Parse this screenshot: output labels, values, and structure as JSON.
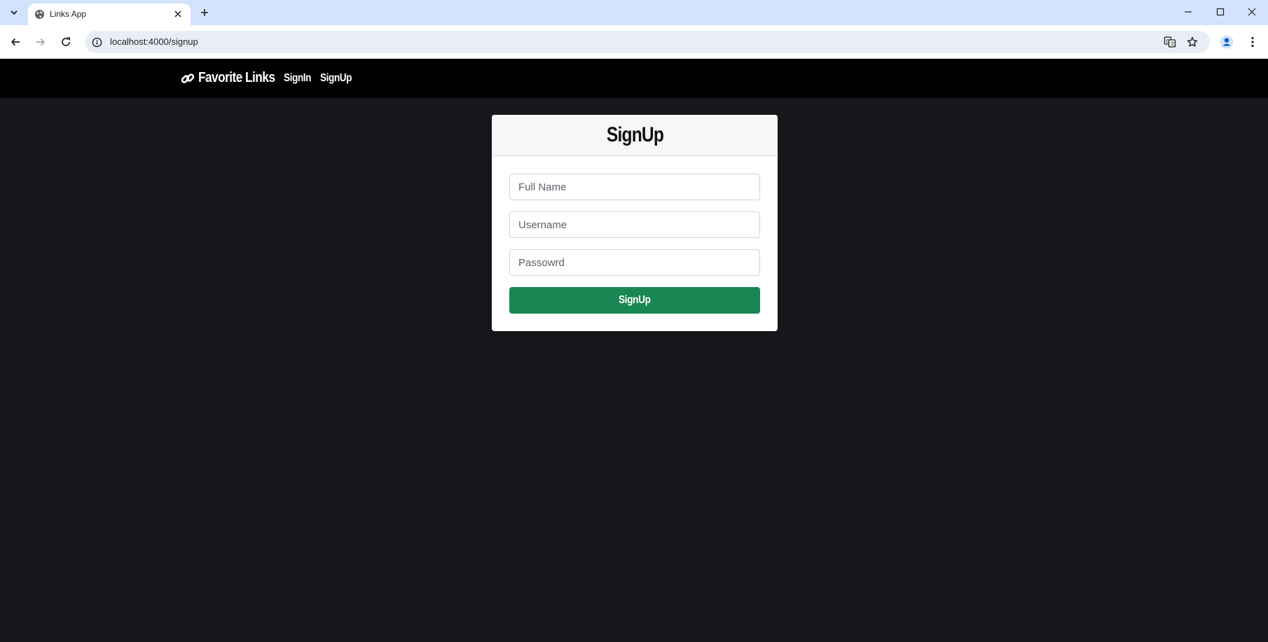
{
  "browser": {
    "tab": {
      "title": "Links App",
      "favicon": "globe-icon"
    },
    "url": "localhost:4000/signup",
    "icons": {
      "tab_list": "chevron-down-icon",
      "tab_close": "close-icon",
      "new_tab": "plus-icon",
      "back": "arrow-left-icon",
      "forward": "arrow-right-icon",
      "reload": "reload-icon",
      "site_info": "info-icon",
      "translate": "translate-icon",
      "bookmark": "star-icon",
      "profile": "profile-icon",
      "menu": "kebab-menu-icon",
      "minimize": "minimize-icon",
      "maximize": "maximize-icon",
      "close_window": "close-icon"
    }
  },
  "navbar": {
    "brand": {
      "icon": "link-icon",
      "label": "Favorite Links"
    },
    "links": [
      {
        "label": "SignIn"
      },
      {
        "label": "SignUp"
      }
    ],
    "background": "#000000"
  },
  "signup_card": {
    "title": "SignUp",
    "fields": {
      "fullname": {
        "placeholder": "Full Name",
        "value": ""
      },
      "username": {
        "placeholder": "Username",
        "value": ""
      },
      "password": {
        "placeholder": "Passowrd",
        "value": ""
      }
    },
    "submit_label": "SignUp"
  },
  "colors": {
    "page_background": "#15171b",
    "button_success": "#198754",
    "tabstrip": "#d3e3fd"
  }
}
